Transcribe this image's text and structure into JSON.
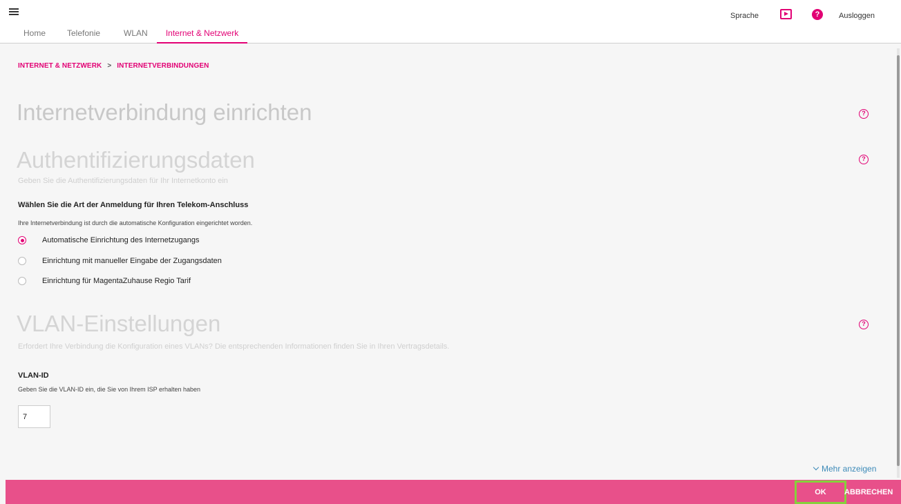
{
  "nav": {
    "tabs": [
      {
        "label": "Home"
      },
      {
        "label": "Telefonie"
      },
      {
        "label": "WLAN"
      },
      {
        "label": "Internet & Netzwerk"
      }
    ],
    "active_tab": "Internet & Netzwerk"
  },
  "topright": {
    "language": "Sprache",
    "help_glyph": "?",
    "logout": "Ausloggen"
  },
  "breadcrumb": {
    "root": "INTERNET & NETZWERK",
    "separator": ">",
    "current": "INTERNETVERBINDUNGEN"
  },
  "main": {
    "title": "Internetverbindung einrichten",
    "help_glyph": "?",
    "auth": {
      "heading": "Authentifizierungsdaten",
      "subtitle": "Geben Sie die Authentifizierungsdaten für Ihr Internetkonto ein",
      "question": "Wählen Sie die Art der Anmeldung für Ihren Telekom-Anschluss",
      "info": "Ihre Internetverbindung ist durch die automatische Konfiguration eingerichtet worden.",
      "options": [
        {
          "label": "Automatische Einrichtung des Internetzugangs",
          "checked": true
        },
        {
          "label": "Einrichtung mit manueller Eingabe der Zugangsdaten",
          "checked": false
        },
        {
          "label": "Einrichtung für MagentaZuhause Regio Tarif",
          "checked": false
        }
      ]
    },
    "vlan": {
      "heading": "VLAN-Einstellungen",
      "subtitle": "Erfordert Ihre Verbindung die Konfiguration eines VLANs? Die entsprechenden Informationen finden Sie in Ihren Vertragsdetails.",
      "field_label": "VLAN-ID",
      "field_hint": "Geben Sie die VLAN-ID ein, die Sie von Ihrem ISP erhalten haben",
      "field_value": "7"
    },
    "more_link": "Mehr anzeigen"
  },
  "footer": {
    "ok": "OK",
    "cancel": "ABBRECHEN"
  },
  "colors": {
    "accent": "#e20074",
    "footer_bg": "#e8508a",
    "highlight": "#86d13c",
    "link": "#3c8ab8"
  },
  "icons": {
    "menu": "hamburger-menu-icon",
    "screen": "screen-play-icon",
    "help": "help-circle-icon",
    "chevron": "chevron-down-icon"
  }
}
